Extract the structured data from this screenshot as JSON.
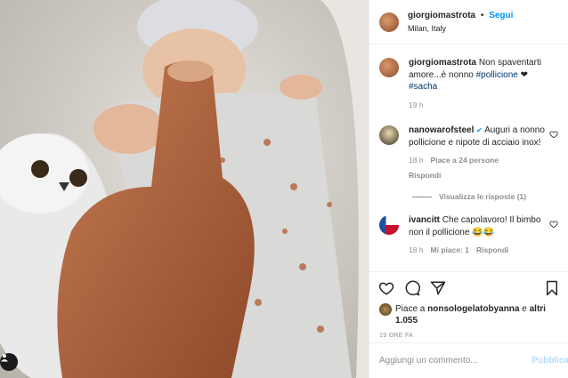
{
  "post": {
    "username": "giorgiomastrota",
    "follow_label": "Segui",
    "location": "Milan, Italy",
    "separator": "•"
  },
  "caption": {
    "username": "giorgiomastrota",
    "text_before": "Non spaventarti amore...è nonno",
    "hashtag1": "#pollicione",
    "emoji": "❤",
    "hashtag2": "#sacha",
    "time": "19 h"
  },
  "comments": [
    {
      "username": "nanowarofsteel",
      "verified": "✔",
      "text": "Auguri a nonno pollicione e nipote di acciaio inox!",
      "time": "18 h",
      "likes": "Piace a 24 persone",
      "reply": "Rispondi",
      "view_replies": "Visualizza le risposte (1)"
    },
    {
      "username": "ivancitt",
      "text": "Che capolavoro! Il bimbo non il pollicione",
      "emoji": "😂😂",
      "time": "18 h",
      "likes": "Mi piace: 1",
      "reply": "Rispondi"
    }
  ],
  "likes": {
    "prefix": "Piace a",
    "user": "nonsologelatobyanna",
    "connector": "e",
    "others": "altri 1.055"
  },
  "time_ago": "19 ORE FA",
  "add_comment": {
    "placeholder": "Aggiungi un commento...",
    "post_label": "Pubblica"
  },
  "icons": [
    "heart-icon",
    "comment-icon",
    "share-icon",
    "bookmark-icon",
    "user-tag-icon"
  ],
  "colors": {
    "link": "#00376b",
    "accent": "#0095f6",
    "muted": "#8e8e8e",
    "post_disabled": "#b3dbff"
  }
}
